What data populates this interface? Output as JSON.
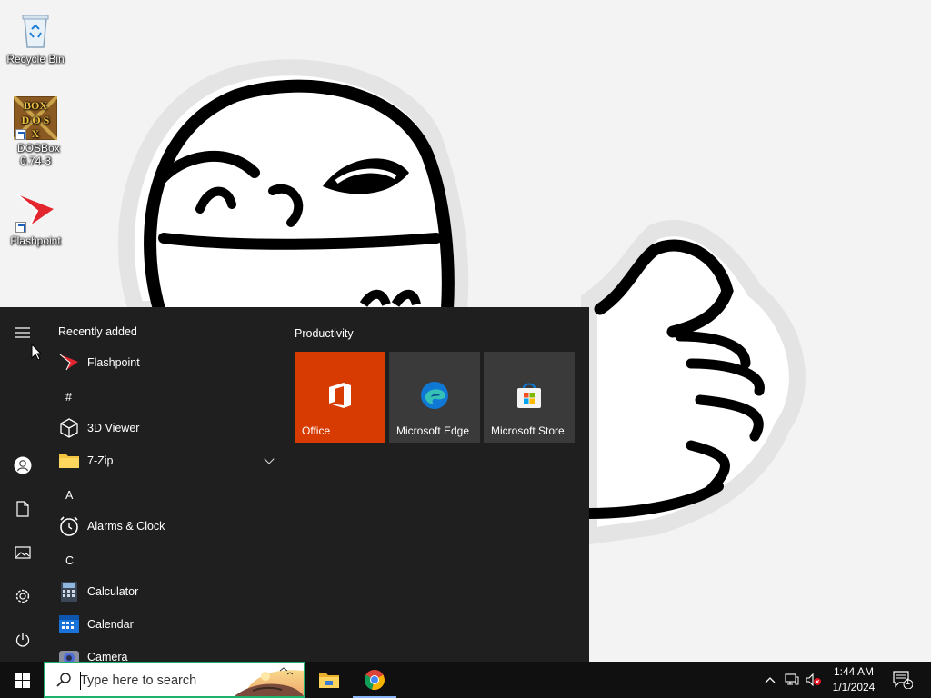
{
  "desktop": {
    "icons": [
      {
        "label": "Recycle Bin"
      },
      {
        "label": "DOSBox 0.74-3"
      },
      {
        "label": "Flashpoint"
      }
    ]
  },
  "start_menu": {
    "recently_added_header": "Recently added",
    "apps": [
      {
        "label": "Flashpoint",
        "icon": "flashpoint-icon"
      },
      {
        "label": "3D Viewer",
        "icon": "cube-icon"
      },
      {
        "label": "7-Zip",
        "icon": "folder-icon"
      },
      {
        "label": "Alarms & Clock",
        "icon": "alarm-clock-icon"
      },
      {
        "label": "Calculator",
        "icon": "calculator-icon"
      },
      {
        "label": "Calendar",
        "icon": "calendar-icon"
      },
      {
        "label": "Camera",
        "icon": "camera-icon"
      }
    ],
    "letters": [
      "#",
      "A",
      "C"
    ],
    "tiles_group": "Productivity",
    "tiles": [
      {
        "label": "Office",
        "color": "#d83b01"
      },
      {
        "label": "Microsoft Edge",
        "color": "#3a3a3a"
      },
      {
        "label": "Microsoft Store",
        "color": "#3a3a3a"
      }
    ],
    "rail": [
      "hamburger-icon",
      "user-icon",
      "document-icon",
      "pictures-icon",
      "settings-icon",
      "power-icon"
    ]
  },
  "taskbar": {
    "search_placeholder": "Type here to search",
    "apps": [
      "file-explorer-icon",
      "chrome-icon"
    ],
    "clock_time": "1:44 AM",
    "clock_date": "1/1/2024",
    "notification_count": "1"
  },
  "colors": {
    "start_bg": "#1f1f1f",
    "taskbar_bg": "#101010",
    "search_border": "#1fb26c",
    "office_tile": "#d83b01"
  }
}
